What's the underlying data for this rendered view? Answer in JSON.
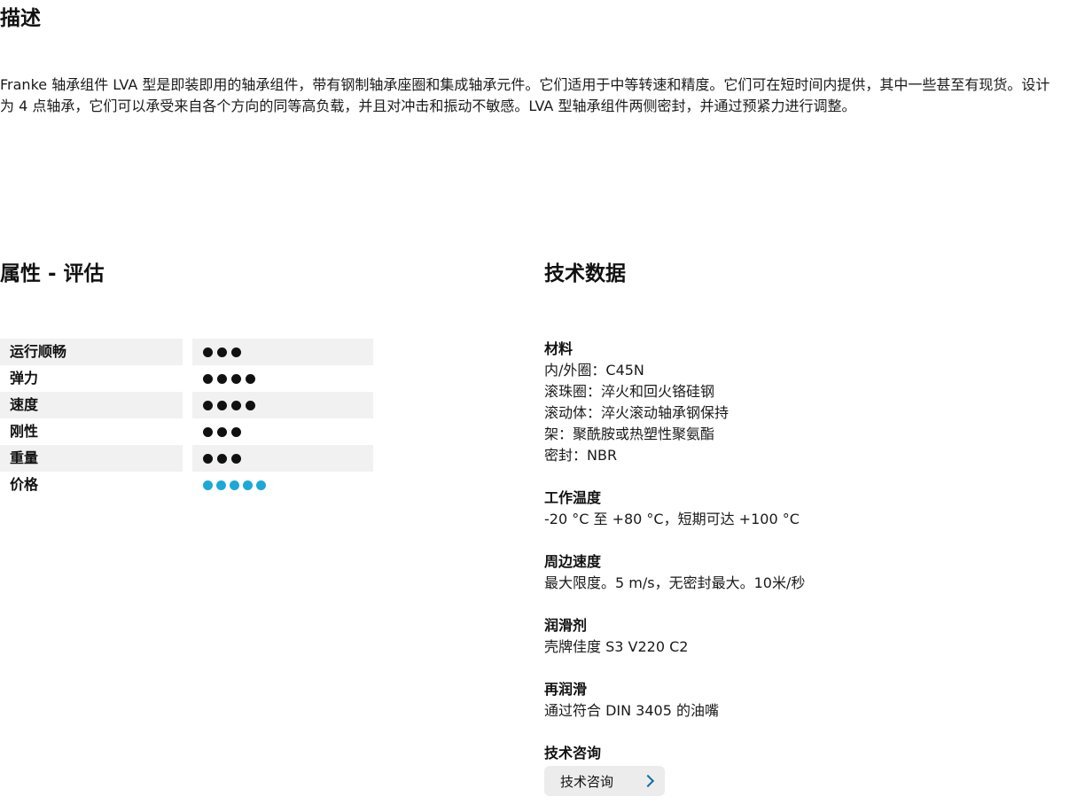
{
  "description": {
    "heading": "描述",
    "text": "Franke 轴承组件 LVA 型是即装即用的轴承组件，带有钢制轴承座圈和集成轴承元件。它们适用于中等转速和精度。它们可在短时间内提供，其中一些甚至有现货。设计为 4 点轴承，它们可以承受来自各个方向的同等高负载，并且对冲击和振动不敏感。LVA 型轴承组件两侧密封，并通过预紧力进行调整。"
  },
  "ratings": {
    "heading": "属性 - 评估",
    "rows": [
      {
        "label": "运行顺畅",
        "dots": 3,
        "color": "#111111"
      },
      {
        "label": "弹力",
        "dots": 4,
        "color": "#111111"
      },
      {
        "label": "速度",
        "dots": 4,
        "color": "#111111"
      },
      {
        "label": "刚性",
        "dots": 3,
        "color": "#111111"
      },
      {
        "label": "重量",
        "dots": 3,
        "color": "#111111"
      },
      {
        "label": "价格",
        "dots": 5,
        "color": "#1ba9d6"
      }
    ]
  },
  "tech": {
    "heading": "技术数据",
    "groups": [
      {
        "title": "材料",
        "lines": [
          "内/外圈：C45N",
          "滚珠圈：淬火和回火铬硅钢",
          "滚动体：淬火滚动轴承钢保持",
          "架：聚酰胺或热塑性聚氨酯",
          "密封：NBR"
        ]
      },
      {
        "title": "工作温度",
        "lines": [
          "-20 °C 至 +80 °C，短期可达 +100 °C"
        ]
      },
      {
        "title": "周边速度",
        "lines": [
          "最大限度。5 m/s，无密封最大。10米/秒"
        ]
      },
      {
        "title": "润滑剂",
        "lines": [
          "壳牌佳度 S3 V220 C2"
        ]
      },
      {
        "title": "再润滑",
        "lines": [
          "通过符合 DIN 3405 的油嘴"
        ]
      }
    ],
    "consult": {
      "title": "技术咨询",
      "button_label": "技术咨询",
      "button_icon": "chevron-right-icon"
    }
  }
}
